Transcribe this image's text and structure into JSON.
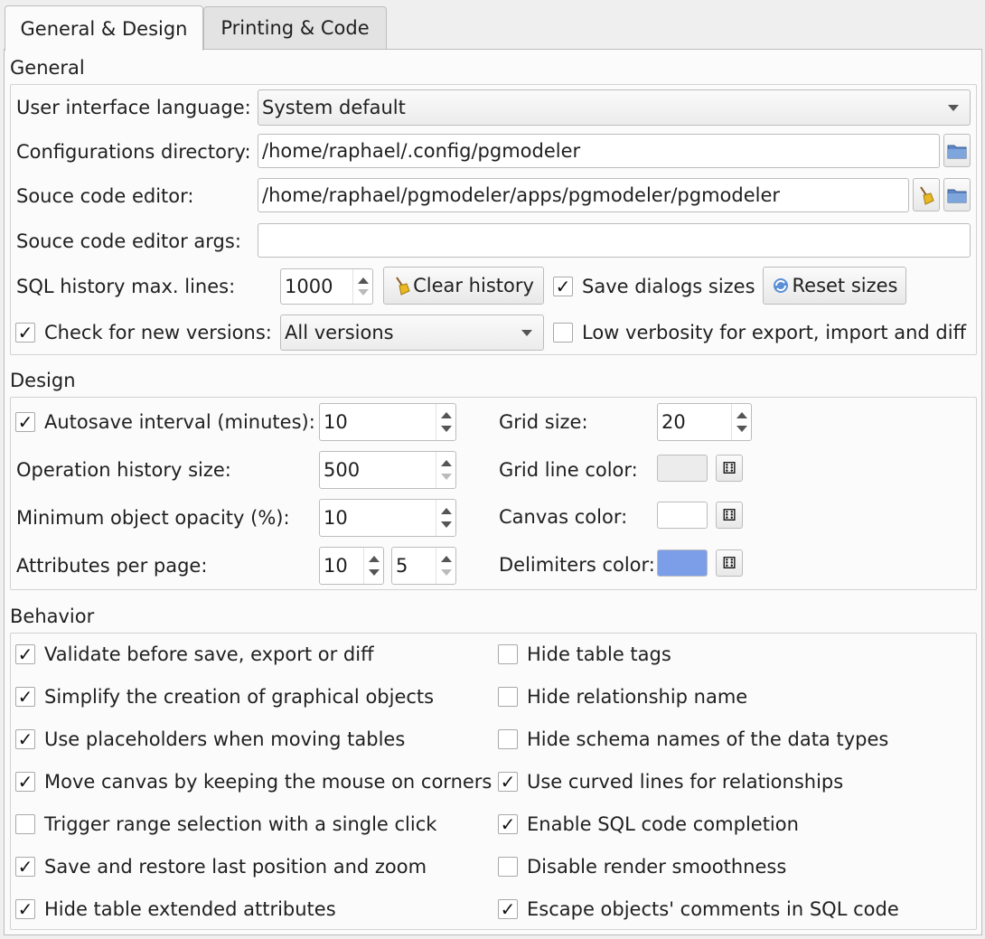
{
  "tabs": [
    "General & Design",
    "Printing & Code"
  ],
  "general": {
    "title": "General",
    "ui_language_label": "User interface language:",
    "ui_language_value": "System default",
    "config_dir_label": "Configurations directory:",
    "config_dir_value": "/home/raphael/.config/pgmodeler",
    "source_editor_label": "Souce code editor:",
    "source_editor_value": "/home/raphael/pgmodeler/apps/pgmodeler/pgmodeler",
    "source_editor_args_label": "Souce code editor args:",
    "source_editor_args_value": "",
    "sql_history_label": "SQL history max. lines:",
    "sql_history_value": "1000",
    "clear_history_label": "Clear history",
    "save_dialogs_label": "Save dialogs sizes",
    "save_dialogs_checked": true,
    "reset_sizes_label": "Reset sizes",
    "check_versions_label": "Check for new versions:",
    "check_versions_checked": true,
    "check_versions_value": "All versions",
    "low_verbosity_label": "Low verbosity for export, import and diff",
    "low_verbosity_checked": false
  },
  "design": {
    "title": "Design",
    "autosave_label": "Autosave interval (minutes):",
    "autosave_checked": true,
    "autosave_value": "10",
    "op_history_label": "Operation history size:",
    "op_history_value": "500",
    "min_opacity_label": "Minimum object opacity (%):",
    "min_opacity_value": "10",
    "attrs_per_page_label": "Attributes per page:",
    "attrs_per_page_value1": "10",
    "attrs_per_page_value2": "5",
    "grid_size_label": "Grid size:",
    "grid_size_value": "20",
    "grid_line_color_label": "Grid line color:",
    "grid_line_color": "#ececec",
    "canvas_color_label": "Canvas color:",
    "canvas_color": "#ffffff",
    "delimiters_color_label": "Delimiters color:",
    "delimiters_color": "#7c9ee8"
  },
  "behavior": {
    "title": "Behavior",
    "left": [
      {
        "label": "Validate before save, export or diff",
        "checked": true
      },
      {
        "label": "Simplify the creation of graphical objects",
        "checked": true
      },
      {
        "label": "Use placeholders when moving tables",
        "checked": true
      },
      {
        "label": "Move canvas by keeping the mouse on corners",
        "checked": true
      },
      {
        "label": "Trigger range selection with a single click",
        "checked": false
      },
      {
        "label": "Save and restore last position and zoom",
        "checked": true
      },
      {
        "label": "Hide table extended attributes",
        "checked": true
      }
    ],
    "right": [
      {
        "label": "Hide table tags",
        "checked": false
      },
      {
        "label": "Hide relationship name",
        "checked": false
      },
      {
        "label": "Hide schema names of the data types",
        "checked": false
      },
      {
        "label": "Use curved lines for relationships",
        "checked": true
      },
      {
        "label": "Enable SQL code completion",
        "checked": true
      },
      {
        "label": "Disable render smoothness",
        "checked": false
      },
      {
        "label": "Escape objects' comments in SQL code",
        "checked": true
      }
    ]
  },
  "check_glyph": "✓"
}
